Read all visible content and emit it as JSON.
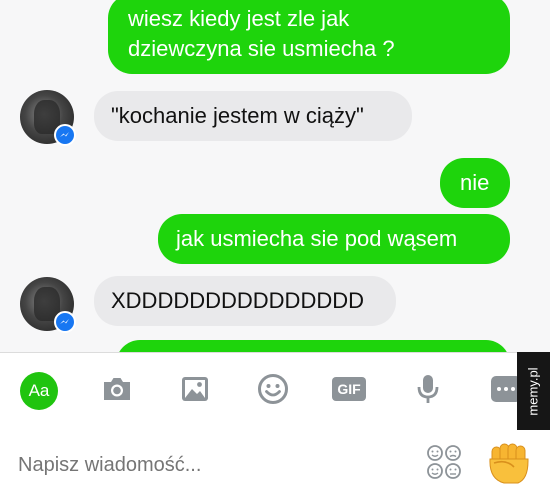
{
  "messages": [
    {
      "sender": "me",
      "text": "wiesz kiedy jest zle jak\ndziewczyna sie usmiecha ?"
    },
    {
      "sender": "contact",
      "text": "\"kochanie jestem w ciąży\""
    },
    {
      "sender": "me",
      "text": "nie"
    },
    {
      "sender": "me",
      "text": "jak usmiecha sie pod wąsem"
    },
    {
      "sender": "contact",
      "text": "XDDDDDDDDDDDDDDD"
    },
    {
      "sender": "me",
      "text": ""
    }
  ],
  "toolbar": {
    "aa_label": "Aa",
    "gif_label": "GIF",
    "icons": [
      "camera-icon",
      "image-icon",
      "smiley-icon",
      "gif-icon",
      "microphone-icon",
      "more-icon"
    ]
  },
  "composer": {
    "placeholder": "Napisz wiadomość..."
  },
  "watermark": "memy.pl",
  "colors": {
    "outgoing_bubble": "#1ed40c",
    "incoming_bubble": "#e9e9eb",
    "accent": "#20c40f",
    "messenger_badge": "#1877f2",
    "icon_gray": "#8d9398"
  }
}
